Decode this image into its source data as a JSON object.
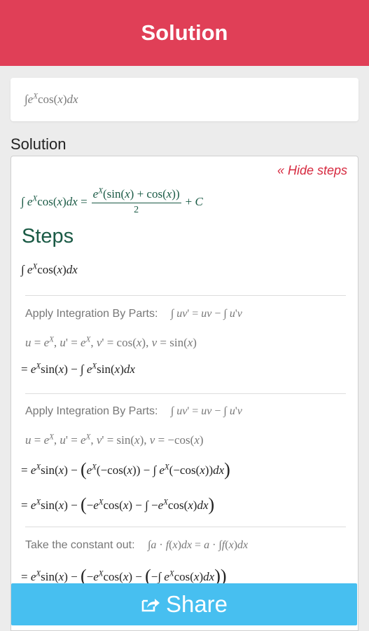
{
  "header": {
    "title": "Solution"
  },
  "input": {
    "expression": "∫eˣcos(x)dx"
  },
  "solution_label": "Solution",
  "hide_steps_label": "« Hide steps",
  "steps_title": "Steps",
  "apply_ibp_label": "Apply Integration By Parts:",
  "take_constant_label": "Take the constant out:",
  "share_label": "Share",
  "colors": {
    "header": "#e03f57",
    "accent_red": "#d6293f",
    "steps_green": "#1a5a45",
    "share": "#47bff0"
  },
  "icons": {
    "share": "share-box-arrow-icon"
  }
}
